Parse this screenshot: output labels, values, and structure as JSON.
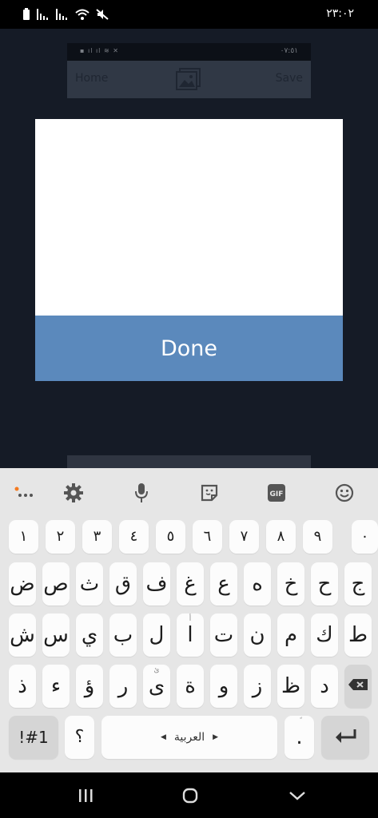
{
  "status_bar": {
    "time": "٢٣:٠٢",
    "icons": [
      "battery-icon",
      "signal-icon",
      "signal-icon",
      "wifi-icon",
      "mute-icon"
    ]
  },
  "background_app": {
    "mini_status_time": "٠٧:٥١",
    "home_label": "Home",
    "save_label": "Save"
  },
  "dialog": {
    "done_label": "Done"
  },
  "keyboard": {
    "toolbar": [
      "more-icon",
      "gear-icon",
      "microphone-icon",
      "sticker-icon",
      "gif-icon",
      "emoji-icon"
    ],
    "gif_label": "GIF",
    "row1": [
      "١",
      "٢",
      "٣",
      "٤",
      "٥",
      "٦",
      "٧",
      "٨",
      "٩",
      "٠"
    ],
    "row2": [
      "ض",
      "ص",
      "ث",
      "ق",
      "ف",
      "غ",
      "ع",
      "ه",
      "خ",
      "ح",
      "ج"
    ],
    "row3": [
      "ش",
      "س",
      "ي",
      "ب",
      "ل",
      "ا",
      "ت",
      "ن",
      "م",
      "ك",
      "ط"
    ],
    "row4": [
      "ذ",
      "ء",
      "ؤ",
      "ر",
      "ى",
      "ة",
      "و",
      "ز",
      "ظ",
      "د"
    ],
    "symbols_label": "!#1",
    "question_label": "؟",
    "space_label": "العربية",
    "period_label": ".",
    "hints": {
      "alef": "أ",
      "ya": "ئ",
      "period": "ً"
    }
  },
  "nav_bar": {
    "buttons": [
      "recents-icon",
      "home-icon",
      "back-icon"
    ]
  },
  "colors": {
    "done_button": "#5b89bc",
    "keyboard_bg": "#e6e6e6",
    "key_bg": "#fcfcfc",
    "overlay_bg": "#141a24",
    "accent_dot": "#f47a20"
  }
}
